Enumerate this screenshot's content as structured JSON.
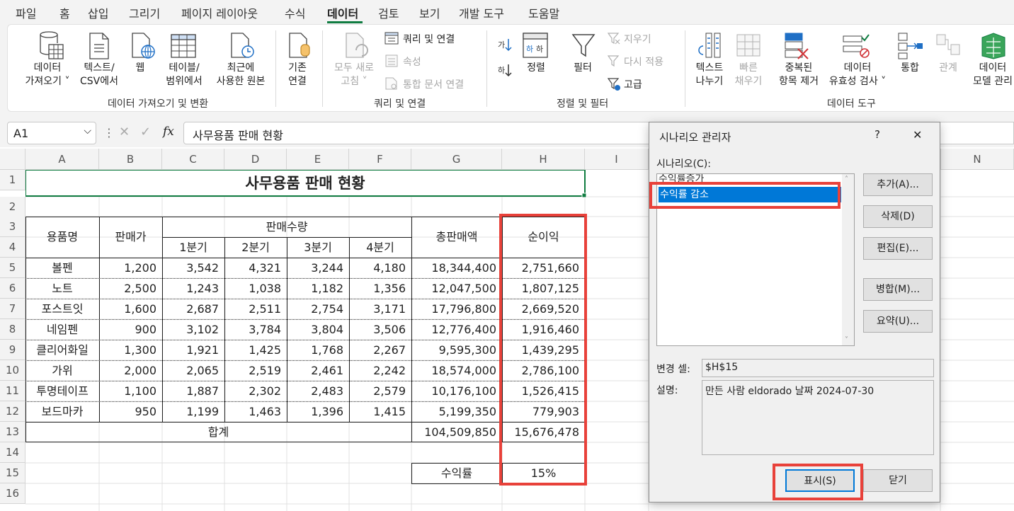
{
  "menu": {
    "tabs": [
      "파일",
      "홈",
      "삽입",
      "그리기",
      "페이지 레이아웃",
      "수식",
      "데이터",
      "검토",
      "보기",
      "개발 도구",
      "도움말"
    ]
  },
  "ribbon": {
    "get_data": [
      "데이터",
      "가져오기 ˅"
    ],
    "text_csv": [
      "텍스트/",
      "CSV에서"
    ],
    "web": "웹",
    "table_range": [
      "테이블/",
      "범위에서"
    ],
    "recent": [
      "최근에",
      "사용한 원본"
    ],
    "existing": [
      "기존",
      "연결"
    ],
    "refresh_all": [
      "모두 새로",
      "고침 ˅"
    ],
    "queries": "쿼리 및 연결",
    "properties": "속성",
    "edit_links": "통합 문서 연결",
    "sort": "정렬",
    "filter": "필터",
    "clear": "지우기",
    "reapply": "다시 적용",
    "advanced": "고급",
    "text_to_col": [
      "텍스트",
      "나누기"
    ],
    "flash_fill": [
      "빠른",
      "채우기"
    ],
    "remove_dup": [
      "중복된",
      "항목 제거"
    ],
    "validation": [
      "데이터",
      "유효성 검사 ˅"
    ],
    "consolidate": "통합",
    "relations": "관계",
    "data_model": [
      "데이터",
      "모델 관리"
    ],
    "groups": [
      "데이터 가져오기 및 변환",
      "쿼리 및 연결",
      "정렬 및 필터",
      "데이터 도구"
    ]
  },
  "formula_bar": {
    "name_box": "A1",
    "formula": "사무용품 판매 현황",
    "fx": "fx"
  },
  "columns": [
    "A",
    "B",
    "C",
    "D",
    "E",
    "F",
    "G",
    "H",
    "I",
    "N"
  ],
  "rows": [
    "1",
    "2",
    "3",
    "4",
    "5",
    "6",
    "7",
    "8",
    "9",
    "10",
    "11",
    "12",
    "13",
    "14",
    "15",
    "16"
  ],
  "sheet": {
    "title": "사무용품 판매 현황",
    "hdr_item": "용품명",
    "hdr_price": "판매가",
    "hdr_qty": "판매수량",
    "quarters": [
      "1분기",
      "2분기",
      "3분기",
      "4분기"
    ],
    "hdr_total": "총판매액",
    "hdr_profit": "순이익",
    "items": [
      [
        "볼펜",
        "1,200",
        "3,542",
        "4,321",
        "3,244",
        "4,180",
        "18,344,400",
        "2,751,660"
      ],
      [
        "노트",
        "2,500",
        "1,243",
        "1,038",
        "1,182",
        "1,356",
        "12,047,500",
        "1,807,125"
      ],
      [
        "포스트잇",
        "1,600",
        "2,687",
        "2,511",
        "2,754",
        "3,171",
        "17,796,800",
        "2,669,520"
      ],
      [
        "네임펜",
        "900",
        "3,102",
        "3,784",
        "3,804",
        "3,506",
        "12,776,400",
        "1,916,460"
      ],
      [
        "클리어화일",
        "1,300",
        "1,921",
        "1,425",
        "1,768",
        "2,267",
        "9,595,300",
        "1,439,295"
      ],
      [
        "가위",
        "2,000",
        "2,065",
        "2,519",
        "2,461",
        "2,242",
        "18,574,000",
        "2,786,100"
      ],
      [
        "투명테이프",
        "1,100",
        "1,887",
        "2,302",
        "2,483",
        "2,579",
        "10,176,100",
        "1,526,415"
      ],
      [
        "보드마카",
        "950",
        "1,199",
        "1,463",
        "1,396",
        "1,415",
        "5,199,350",
        "779,903"
      ]
    ],
    "sum_label": "합계",
    "sum_total": "104,509,850",
    "sum_profit": "15,676,478",
    "rate_label": "수익률",
    "rate_value": "15%"
  },
  "dialog": {
    "title": "시나리오 관리자",
    "help": "?",
    "close": "✕",
    "list_label": "시나리오(C):",
    "scenarios": [
      "수익률증가",
      "수익률 감소"
    ],
    "btn_add": "추가(A)...",
    "btn_delete": "삭제(D)",
    "btn_edit": "편집(E)...",
    "btn_merge": "병합(M)...",
    "btn_summary": "요약(U)...",
    "changing_label": "변경 셀:",
    "changing_value": "$H$15",
    "desc_label": "설명:",
    "desc_value": "만든 사람 eldorado 날짜 2024-07-30",
    "btn_show": "표시(S)",
    "btn_close": "닫기"
  },
  "colors": {
    "excel_green": "#107c41",
    "highlight_red": "#e8413a",
    "selection_blue": "#0078d7"
  }
}
